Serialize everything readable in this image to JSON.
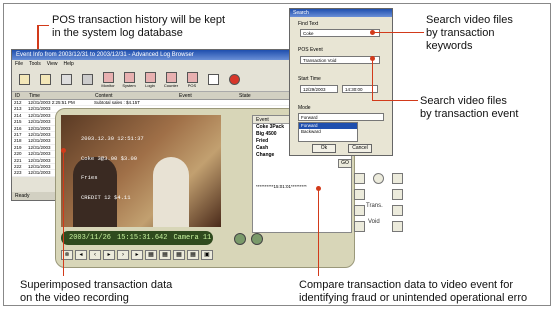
{
  "callouts": {
    "top_left": [
      "POS transaction history will be kept",
      "in the system log database"
    ],
    "top_right": [
      "Search video files",
      "by transaction",
      "keywords"
    ],
    "mid_right": [
      "Search video files",
      "by transaction event"
    ],
    "bottom_left": [
      "Superimposed transaction data",
      "on the video recording"
    ],
    "bottom_right": [
      "Compare transaction data to video event for",
      "identifying fraud or unintended operational erro"
    ]
  },
  "log_window": {
    "title": "Event Info from 2003/12/31 to 2003/12/31 - Advanced Log Browser",
    "menu": [
      "File",
      "Tools",
      "View",
      "Help"
    ],
    "toolbar": [
      "",
      "",
      "",
      "",
      "Monitor",
      "System",
      "Login",
      "Counter",
      "POS",
      "POS",
      ""
    ],
    "columns": [
      "ID",
      "Time",
      "Content",
      "Event",
      "State"
    ],
    "rows": [
      {
        "id": "212",
        "time": "12/31/2003 2:25:51 PM",
        "content": "Subtotal sales : $4.15T"
      },
      {
        "id": "213",
        "time": "12/31/2003",
        "content": ""
      },
      {
        "id": "214",
        "time": "12/31/2003",
        "content": ""
      },
      {
        "id": "215",
        "time": "12/31/2003",
        "content": ""
      },
      {
        "id": "216",
        "time": "12/31/2003",
        "content": ""
      },
      {
        "id": "217",
        "time": "12/31/2003",
        "content": ""
      },
      {
        "id": "218",
        "time": "12/31/2003",
        "content": ""
      },
      {
        "id": "219",
        "time": "12/31/2003",
        "content": ""
      },
      {
        "id": "220",
        "time": "12/31/2003",
        "content": ""
      },
      {
        "id": "221",
        "time": "12/31/2003",
        "content": ""
      },
      {
        "id": "222",
        "time": "12/31/2003",
        "content": ""
      },
      {
        "id": "223",
        "time": "12/31/2003",
        "content": ""
      }
    ],
    "status": "Ready"
  },
  "player": {
    "overlay_lines": [
      "2003.12.30 12:51:37",
      "Coke 3@3.00 $3.00",
      "Fries",
      "CREDIT 12 $4.11"
    ],
    "date": "2003/11/26",
    "time": "15:15:31.642",
    "camera": "Camera 11",
    "event_header": "Event",
    "event_items": [
      "Coke 3Pack",
      "Big 4500",
      "Fried",
      "Cash",
      "Change"
    ],
    "event_marker": "**********15:01:01*********",
    "side_labels": [
      "Trans.",
      "Void"
    ],
    "go_label": "GO"
  },
  "search_dialog": {
    "title": "Search",
    "find_text_label": "Find Text",
    "find_text_value": "Coke",
    "pos_event_label": "POS Event",
    "pos_event_value": "Transaction Void",
    "start_time_label": "Start Time",
    "start_date": "12/29/2003",
    "start_clock": "14:30:00",
    "mode_label": "Mode",
    "mode_value": "Forward",
    "mode_options": [
      "Forward",
      "Backward"
    ],
    "ok_label": "Ok",
    "cancel_label": "Cancel"
  }
}
